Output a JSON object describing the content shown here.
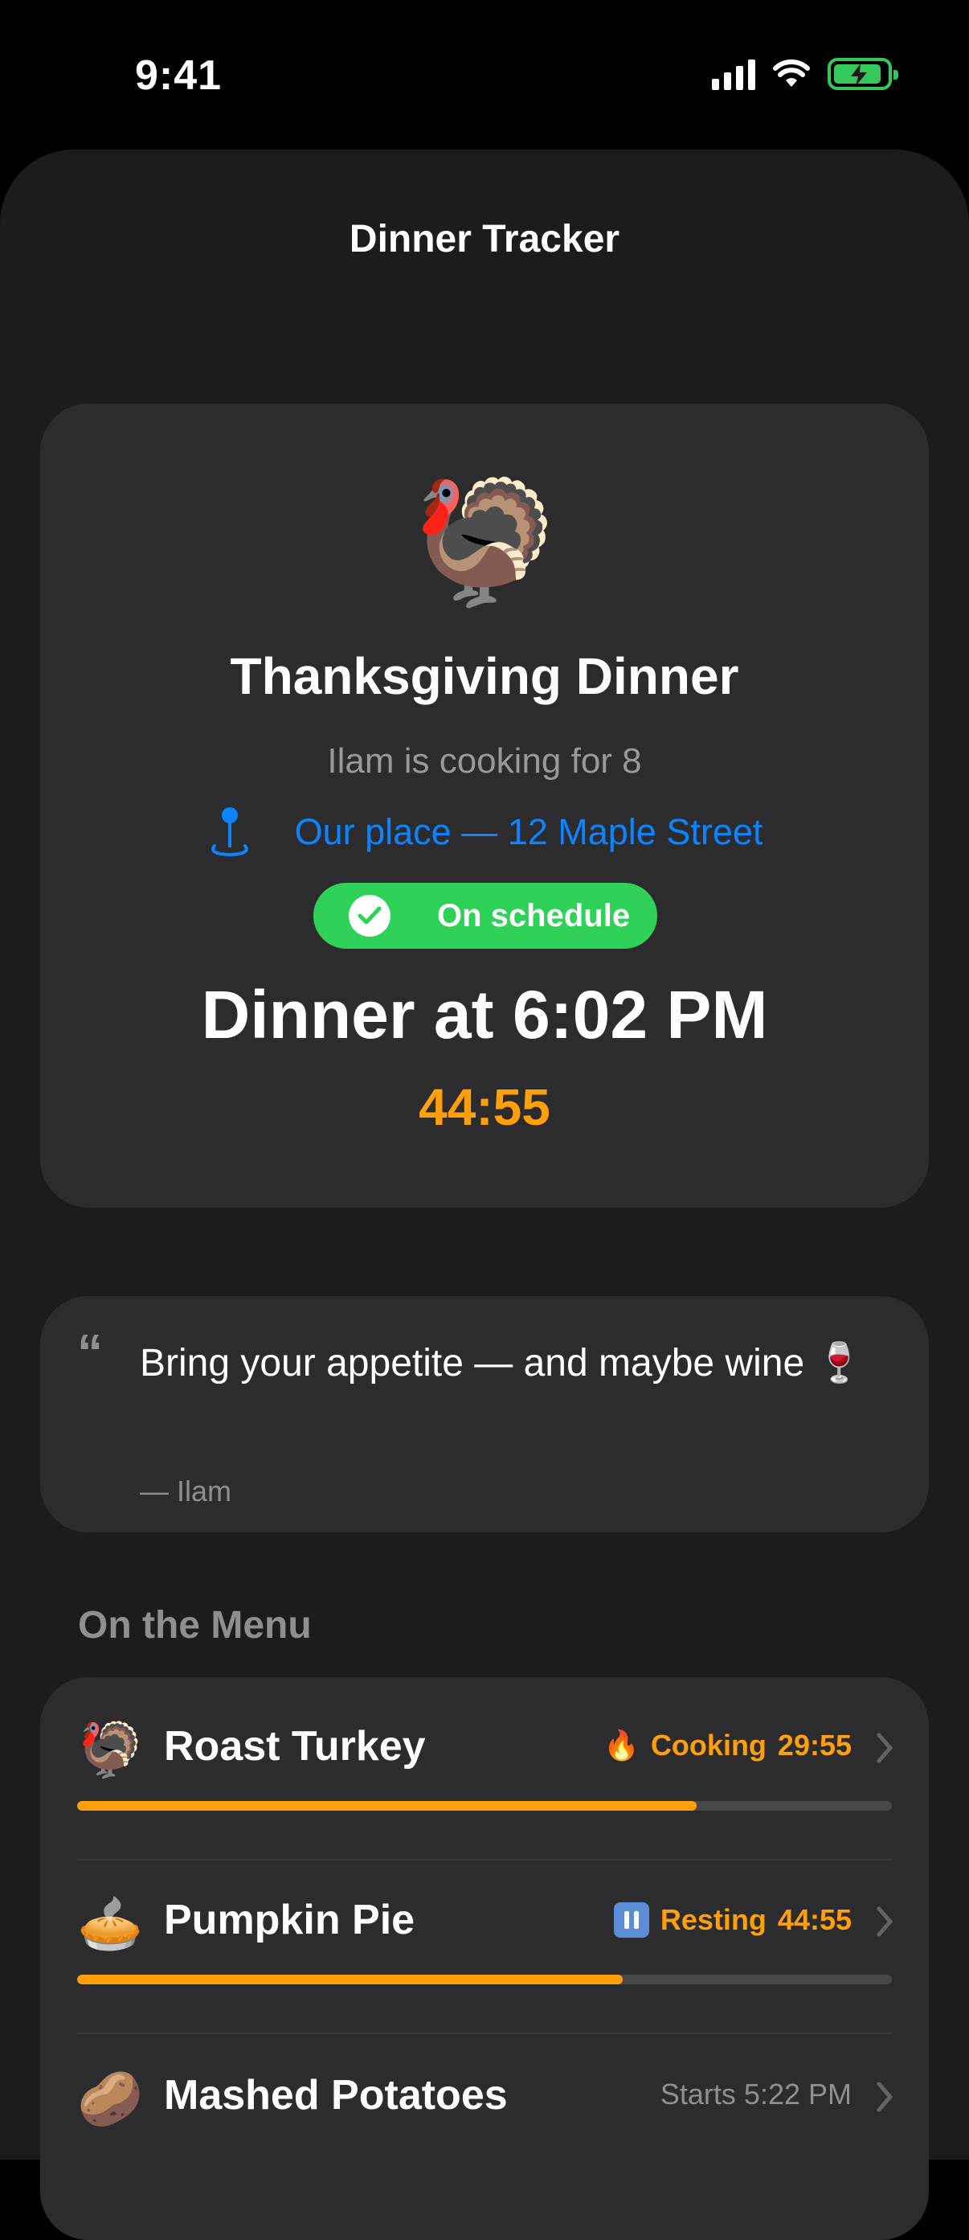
{
  "status_bar": {
    "time": "9:41",
    "battery": "charging"
  },
  "nav": {
    "title": "Dinner Tracker"
  },
  "event": {
    "emoji": "🦃",
    "title": "Thanksgiving Dinner",
    "host_line": "Ilam is cooking for 8",
    "location": "Our place — 12 Maple Street",
    "location_icon": "map-pin-icon",
    "status_badge": "On schedule",
    "status_color": "#30d158",
    "dinner_time": "Dinner at 6:02 PM",
    "countdown": "44:55",
    "accent_color": "#ff9f0a"
  },
  "note": {
    "quote_icon": "quote-icon",
    "text": "Bring your appetite — and maybe wine 🍷",
    "author": "— Ilam"
  },
  "menu": {
    "header": "On the Menu",
    "items": [
      {
        "emoji": "🦃",
        "name": "Roast Turkey",
        "status_icon": "🔥",
        "status": "Cooking",
        "time": "29:55",
        "progress": 0.76
      },
      {
        "emoji": "🥧",
        "name": "Pumpkin Pie",
        "status_icon": "pause-icon",
        "status": "Resting",
        "time": "44:55",
        "progress": 0.67
      },
      {
        "emoji": "🥔",
        "name": "Mashed Potatoes",
        "status": "Starts 5:22 PM"
      }
    ]
  }
}
